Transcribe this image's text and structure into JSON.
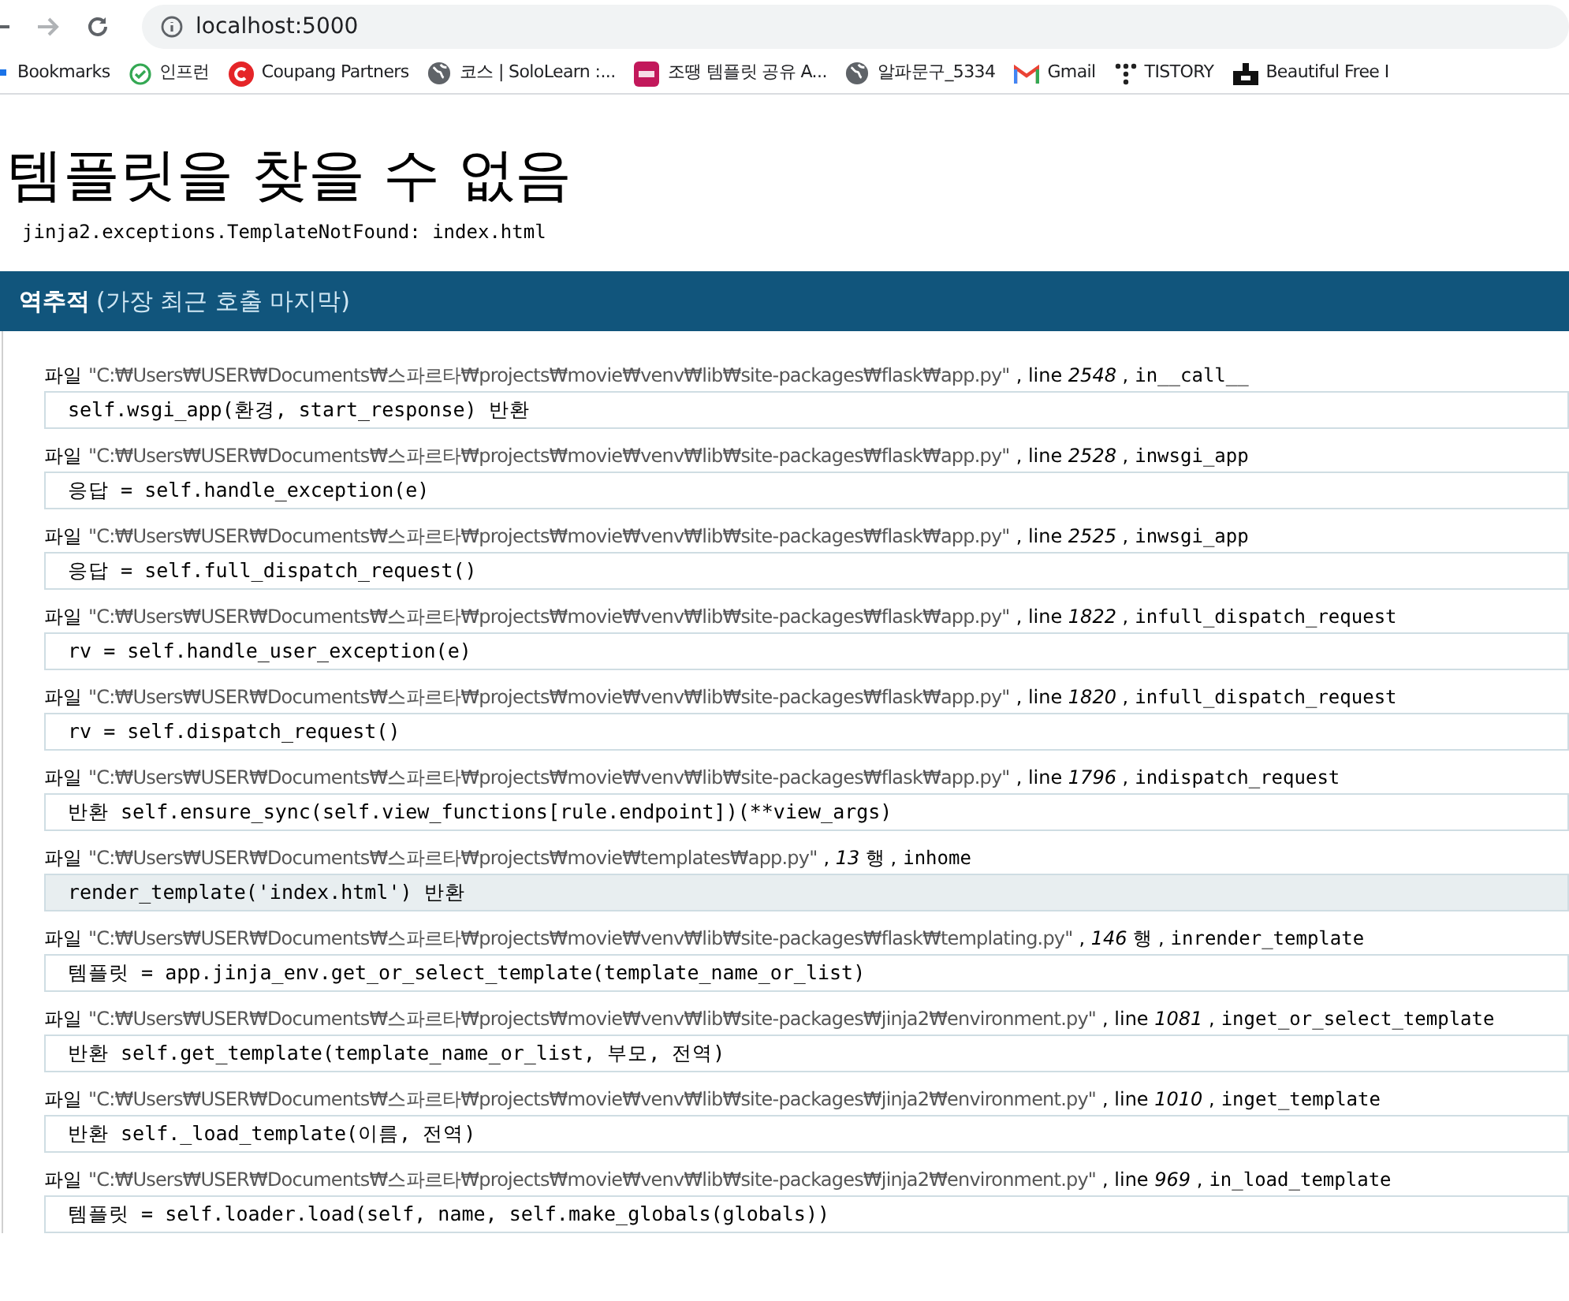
{
  "browser": {
    "url": "localhost:5000",
    "bookmarks": [
      {
        "kind": "apps",
        "label": "Bookmarks"
      },
      {
        "kind": "inflearn",
        "label": "인프런"
      },
      {
        "kind": "coupang",
        "label": "Coupang Partners"
      },
      {
        "kind": "globe",
        "label": "코스 | SoloLearn :..."
      },
      {
        "kind": "ppt",
        "label": "조땡 템플릿 공유 A..."
      },
      {
        "kind": "globe",
        "label": "알파문구_5334"
      },
      {
        "kind": "gmail",
        "label": "Gmail"
      },
      {
        "kind": "tistory",
        "label": "TISTORY"
      },
      {
        "kind": "dark",
        "label": "Beautiful Free I"
      }
    ]
  },
  "page": {
    "title": "템플릿을 찾을 수 없음",
    "exception": "jinja2.exceptions.TemplateNotFound: index.html",
    "traceback_header": {
      "title": "역추적",
      "subtitle": "(가장 최근 호출 마지막)"
    },
    "frames": [
      {
        "file_label": "파일",
        "path": "\"C:₩Users₩USER₩Documents₩스파르타₩projects₩movie₩venv₩lib₩site-packages₩flask₩app.py\"",
        "location": ", line *2548* ,",
        "func": "in__call__",
        "code": "self.wsgi_app(환경, start_response) 반환",
        "selected": false
      },
      {
        "file_label": "파일",
        "path": "\"C:₩Users₩USER₩Documents₩스파르타₩projects₩movie₩venv₩lib₩site-packages₩flask₩app.py\"",
        "location": ", line *2528* ,",
        "func": "inwsgi_app",
        "code": "응답 = self.handle_exception(e)",
        "selected": false
      },
      {
        "file_label": "파일",
        "path": "\"C:₩Users₩USER₩Documents₩스파르타₩projects₩movie₩venv₩lib₩site-packages₩flask₩app.py\"",
        "location": ", line *2525* ,",
        "func": "inwsgi_app",
        "code": "응답 = self.full_dispatch_request()",
        "selected": false
      },
      {
        "file_label": "파일",
        "path": "\"C:₩Users₩USER₩Documents₩스파르타₩projects₩movie₩venv₩lib₩site-packages₩flask₩app.py\"",
        "location": ", line *1822* ,",
        "func": "infull_dispatch_request",
        "code": "rv = self.handle_user_exception(e)",
        "selected": false
      },
      {
        "file_label": "파일",
        "path": "\"C:₩Users₩USER₩Documents₩스파르타₩projects₩movie₩venv₩lib₩site-packages₩flask₩app.py\"",
        "location": ", line *1820* ,",
        "func": "infull_dispatch_request",
        "code": "rv = self.dispatch_request()",
        "selected": false
      },
      {
        "file_label": "파일",
        "path": "\"C:₩Users₩USER₩Documents₩스파르타₩projects₩movie₩venv₩lib₩site-packages₩flask₩app.py\"",
        "location": ", line *1796* ,",
        "func": "indispatch_request",
        "code": "반환 self.ensure_sync(self.view_functions[rule.endpoint])(**view_args)",
        "selected": false
      },
      {
        "file_label": "파일",
        "path": "\"C:₩Users₩USER₩Documents₩스파르타₩projects₩movie₩templates₩app.py\"",
        "location": ", *13* 행 ,",
        "func": "inhome",
        "code": "render_template('index.html') 반환",
        "selected": true
      },
      {
        "file_label": "파일",
        "path": "\"C:₩Users₩USER₩Documents₩스파르타₩projects₩movie₩venv₩lib₩site-packages₩flask₩templating.py\"",
        "location": ", *146* 행 ,",
        "func": "inrender_template",
        "code": "템플릿 = app.jinja_env.get_or_select_template(template_name_or_list)",
        "selected": false
      },
      {
        "file_label": "파일",
        "path": "\"C:₩Users₩USER₩Documents₩스파르타₩projects₩movie₩venv₩lib₩site-packages₩jinja2₩environment.py\"",
        "location": ", line *1081* ,",
        "func": "inget_or_select_template",
        "code": "반환 self.get_template(template_name_or_list, 부모, 전역)",
        "selected": false
      },
      {
        "file_label": "파일",
        "path": "\"C:₩Users₩USER₩Documents₩스파르타₩projects₩movie₩venv₩lib₩site-packages₩jinja2₩environment.py\"",
        "location": ", line *1010* ,",
        "func": "inget_template",
        "code": "반환 self._load_template(이름, 전역)",
        "selected": false
      },
      {
        "file_label": "파일",
        "path": "\"C:₩Users₩USER₩Documents₩스파르타₩projects₩movie₩venv₩lib₩site-packages₩jinja2₩environment.py\"",
        "location": ", line *969* ,",
        "func": "in_load_template",
        "code": "템플릿 = self.loader.load(self, name, self.make_globals(globals))",
        "selected": false
      }
    ]
  }
}
